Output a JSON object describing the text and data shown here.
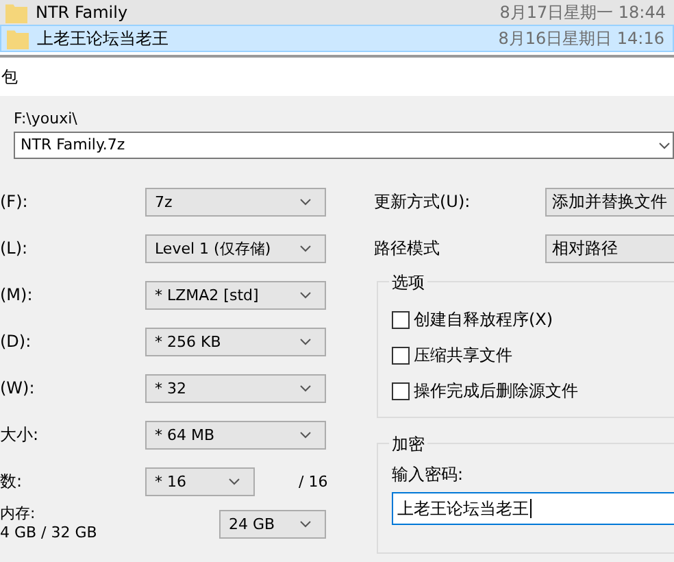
{
  "files": [
    {
      "name": "NTR Family",
      "date": "8月17日星期一 18:44",
      "selected": false
    },
    {
      "name": "上老王论坛当老王",
      "date": "8月16日星期日 14:16",
      "selected": true
    }
  ],
  "dialog": {
    "title": "包",
    "path_label": "F:\\youxi\\",
    "archive_name": "NTR Family.7z",
    "left_fields": [
      {
        "label": "(F):",
        "value": "7z"
      },
      {
        "label": "(L):",
        "value": "Level 1 (仅存储)"
      },
      {
        "label": "(M):",
        "value": "* LZMA2 [std]"
      },
      {
        "label": "(D):",
        "value": "* 256 KB"
      },
      {
        "label": "(W):",
        "value": "* 32"
      },
      {
        "label": "大小:",
        "value": "* 64 MB"
      },
      {
        "label": "数:",
        "value": "* 16",
        "suffix": "/ 16"
      }
    ],
    "memory": {
      "label": "内存:",
      "usage": "4 GB / 32 GB",
      "value": "24 GB"
    },
    "right_fields": [
      {
        "label": "更新方式(U):",
        "value": "添加并替换文件"
      },
      {
        "label": "路径模式",
        "value": "相对路径"
      }
    ],
    "options": {
      "title": "选项",
      "items": [
        {
          "label": "创建自释放程序(X)",
          "checked": false
        },
        {
          "label": "压缩共享文件",
          "checked": false
        },
        {
          "label": "操作完成后删除源文件",
          "checked": false
        }
      ]
    },
    "encryption": {
      "title": "加密",
      "password_label": "输入密码:",
      "password": "上老王论坛当老王"
    }
  }
}
